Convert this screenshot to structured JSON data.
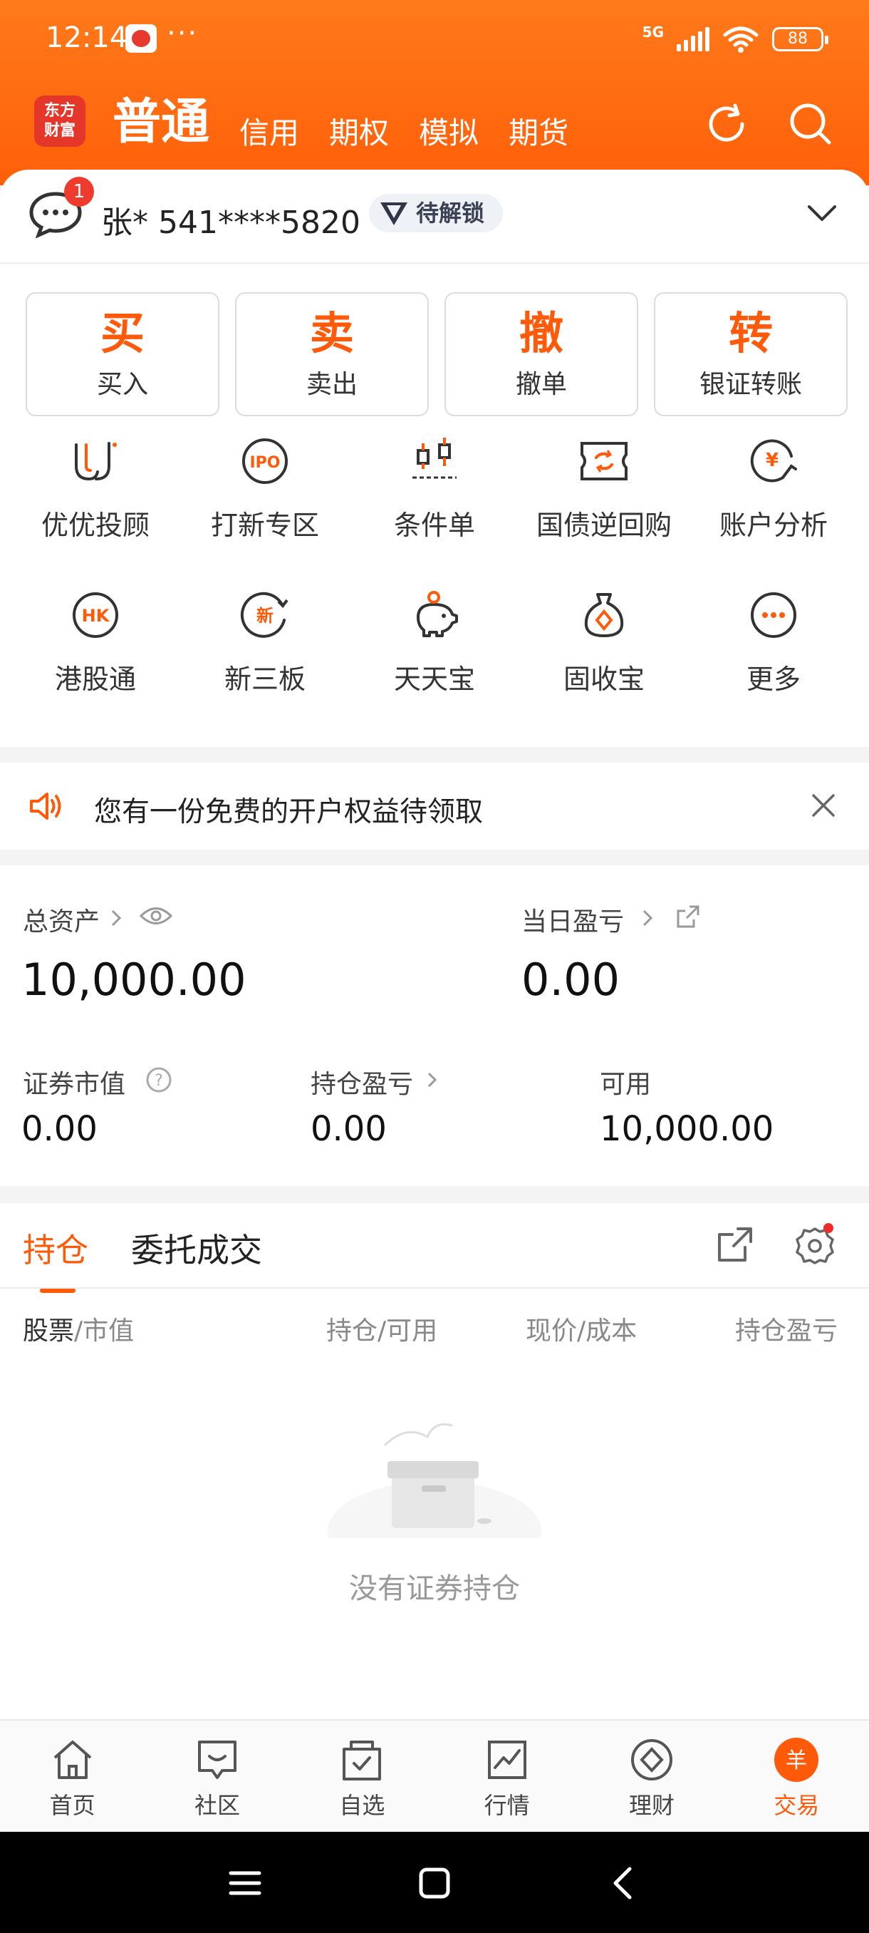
{
  "status": {
    "time": "12:14",
    "network": "5G",
    "battery": "88"
  },
  "topnav": {
    "logo_line1": "东方",
    "logo_line2": "财富",
    "tabs": [
      "普通",
      "信用",
      "期权",
      "模拟",
      "期货"
    ]
  },
  "account": {
    "unread": "1",
    "label": "张* 541****5820",
    "vip_label": "待解锁"
  },
  "trade_buttons": [
    {
      "key": "买",
      "label": "买入"
    },
    {
      "key": "卖",
      "label": "卖出"
    },
    {
      "key": "撤",
      "label": "撤单"
    },
    {
      "key": "转",
      "label": "银证转账"
    }
  ],
  "grid": [
    {
      "label": "优优投顾",
      "icon": "uu-advisor-icon"
    },
    {
      "label": "打新专区",
      "icon": "ipo-icon"
    },
    {
      "label": "条件单",
      "icon": "condition-order-icon"
    },
    {
      "label": "国债逆回购",
      "icon": "reverse-repo-icon"
    },
    {
      "label": "账户分析",
      "icon": "account-analysis-icon"
    },
    {
      "label": "港股通",
      "icon": "hk-connect-icon"
    },
    {
      "label": "新三板",
      "icon": "neeq-icon"
    },
    {
      "label": "天天宝",
      "icon": "piggy-bank-icon"
    },
    {
      "label": "固收宝",
      "icon": "money-bag-icon"
    },
    {
      "label": "更多",
      "icon": "more-icon"
    }
  ],
  "notice": {
    "text": "您有一份免费的开户权益待领取"
  },
  "assets": {
    "total_label": "总资产",
    "total_value": "10,000.00",
    "daily_label": "当日盈亏",
    "daily_value": "0.00",
    "market_label": "证券市值",
    "market_value": "0.00",
    "holding_pl_label": "持仓盈亏",
    "holding_pl_value": "0.00",
    "available_label": "可用",
    "available_value": "10,000.00"
  },
  "positions": {
    "tabs": [
      "持仓",
      "委托成交"
    ],
    "col_stock": "股票",
    "col_stock_sub": "/市值",
    "col_hold": "持仓/可用",
    "col_price": "现价/成本",
    "col_pl": "持仓盈亏",
    "empty": "没有证券持仓"
  },
  "tabbar": [
    {
      "label": "首页",
      "icon": "home-icon"
    },
    {
      "label": "社区",
      "icon": "community-icon"
    },
    {
      "label": "自选",
      "icon": "watchlist-icon"
    },
    {
      "label": "行情",
      "icon": "market-icon"
    },
    {
      "label": "理财",
      "icon": "wealth-icon"
    },
    {
      "label": "交易",
      "icon": "trade-icon"
    }
  ],
  "colors": {
    "accent": "#ff5a0a",
    "header": "#ff6a10"
  }
}
